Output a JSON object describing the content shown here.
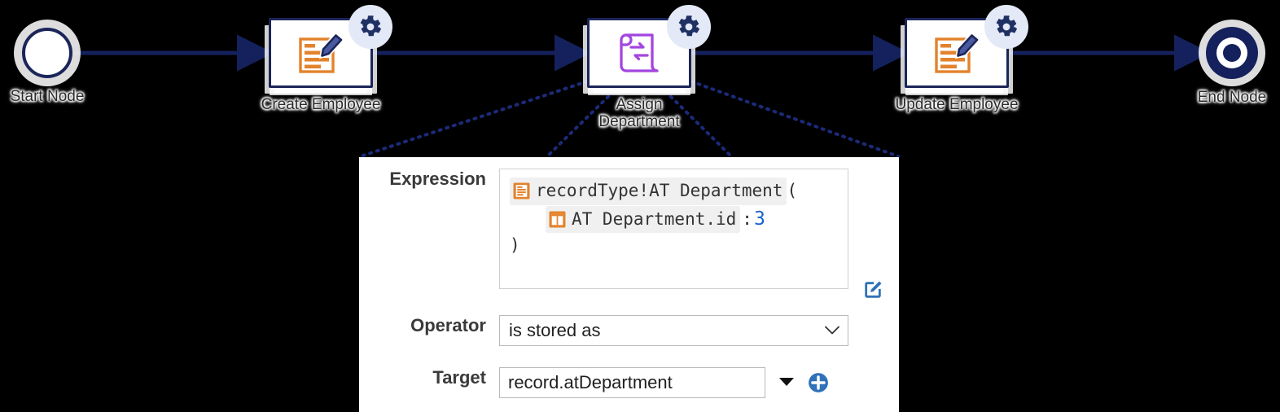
{
  "canvas": {
    "background": "#000000",
    "node_stroke": "#1b2559",
    "connector_color": "#14215c",
    "dotted_connector_color": "#1b2b7a"
  },
  "flow": {
    "nodes": [
      {
        "id": "start",
        "label": "Start Node",
        "type": "start-event",
        "icon": "start-circle-icon"
      },
      {
        "id": "create-employee",
        "label": "Create Employee",
        "type": "script-task",
        "icon": "document-pencil-icon",
        "has_gear": true
      },
      {
        "id": "assign-dept",
        "label": "Assign\nDepartment",
        "label_line1": "Assign",
        "label_line2": "Department",
        "type": "script-task",
        "icon": "scroll-swap-icon",
        "has_gear": true
      },
      {
        "id": "update-employee",
        "label": "Update Employee",
        "type": "script-task",
        "icon": "document-pencil-icon",
        "has_gear": true
      },
      {
        "id": "end",
        "label": "End Node",
        "type": "end-event",
        "icon": "end-circle-icon"
      }
    ]
  },
  "panel": {
    "expression": {
      "label": "Expression",
      "lines": [
        {
          "indent": false,
          "parts": [
            {
              "kind": "token",
              "icon": "recordtype-icon",
              "text": "recordType!AT Department"
            },
            {
              "kind": "paren",
              "text": "("
            }
          ]
        },
        {
          "indent": true,
          "parts": [
            {
              "kind": "token",
              "icon": "field-icon",
              "text": "AT Department.id"
            },
            {
              "kind": "colon",
              "text": ":"
            },
            {
              "kind": "number",
              "text": "3"
            }
          ]
        },
        {
          "indent": false,
          "parts": [
            {
              "kind": "paren",
              "text": ")"
            }
          ]
        }
      ],
      "edit_button_name": "edit-expression-button",
      "token_bg": "#f0f0f0",
      "number_color": "#1763cf",
      "icon_color": "#e3822c"
    },
    "operator": {
      "label": "Operator",
      "value": "is stored as",
      "options": [
        "is stored as"
      ]
    },
    "target": {
      "label": "Target",
      "value": "record.atDepartment",
      "placeholder": "",
      "dropdown_icon": "triangle-down-icon",
      "add_icon": "plus-circle-icon",
      "add_color": "#2f72b8"
    }
  }
}
